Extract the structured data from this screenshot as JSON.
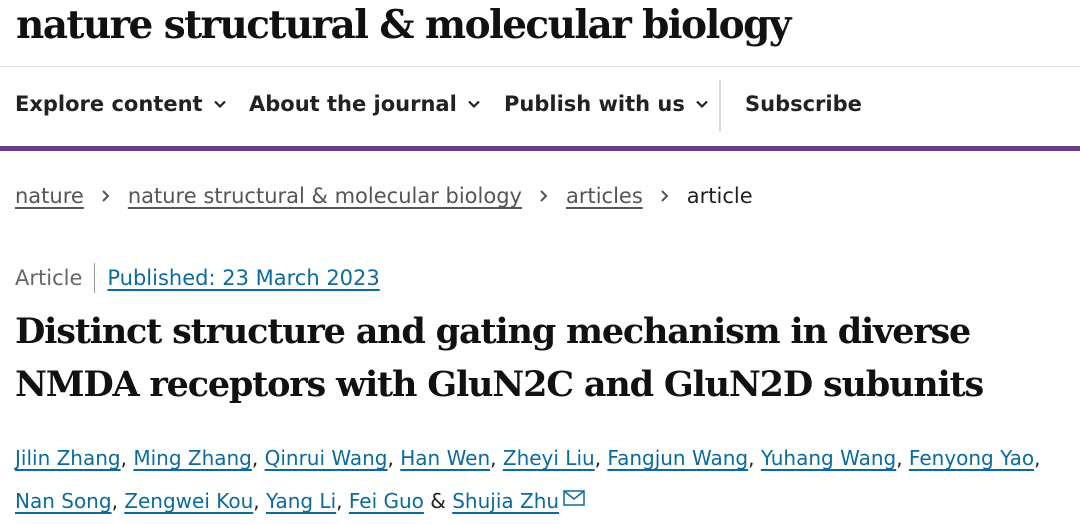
{
  "masthead": {
    "title": "nature structural & molecular biology"
  },
  "nav": {
    "items": [
      {
        "label": "Explore content"
      },
      {
        "label": "About the journal"
      },
      {
        "label": "Publish with us"
      }
    ],
    "subscribe_label": "Subscribe",
    "accent_color": "#6a3d8c"
  },
  "breadcrumb": {
    "items": [
      "nature",
      "nature structural & molecular biology",
      "articles"
    ],
    "current": "article"
  },
  "article": {
    "type": "Article",
    "published": "Published: 23 March 2023",
    "title": "Distinct structure and gating mechanism in diverse NMDA receptors with GluN2C and GluN2D subunits"
  },
  "authors": [
    "Jilin Zhang",
    "Ming Zhang",
    "Qinrui Wang",
    "Han Wen",
    "Zheyi Liu",
    "Fangjun Wang",
    "Yuhang Wang",
    "Fenyong Yao",
    "Nan Song",
    "Zengwei Kou",
    "Yang Li",
    "Fei Guo",
    "Shujia Zhu"
  ],
  "author_separators": [
    ", ",
    ", ",
    ", ",
    ", ",
    ", ",
    ", ",
    ", ",
    ", ",
    ", ",
    ", ",
    ", ",
    " & "
  ],
  "icons": {
    "chevron": "chevron-down-icon",
    "breadcrumb_sep": "chevron-right-icon",
    "corresponding": "mail-icon"
  },
  "link_color": "#0c6b9c"
}
